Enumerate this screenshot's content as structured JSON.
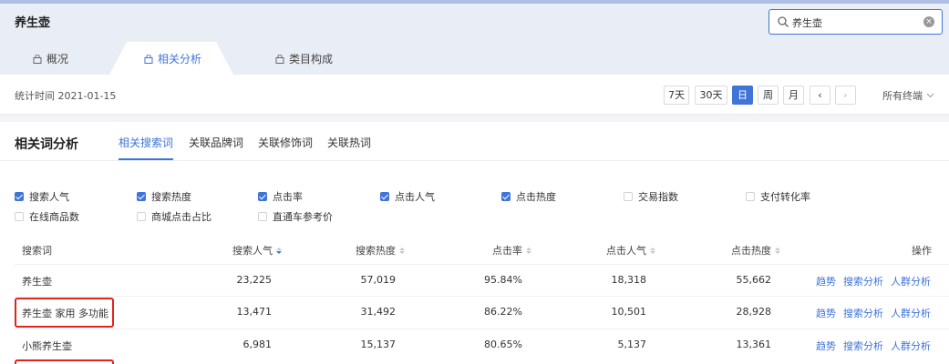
{
  "app": {
    "title": "养生壶"
  },
  "search": {
    "value": "养生壶",
    "placeholder": ""
  },
  "tabs": [
    {
      "label": "概况"
    },
    {
      "label": "相关分析"
    },
    {
      "label": "类目构成"
    }
  ],
  "subbar": {
    "stat_time": "统计时间 2021-01-15",
    "periods": [
      "7天",
      "30天",
      "日",
      "周",
      "月"
    ],
    "prev": "‹",
    "next": "›",
    "channel": "所有终端"
  },
  "card": {
    "title": "相关词分析",
    "tabs": [
      "相关搜索词",
      "关联品牌词",
      "关联修饰词",
      "关联热词"
    ]
  },
  "checkboxes": [
    {
      "label": "搜索人气",
      "checked": true
    },
    {
      "label": "搜索热度",
      "checked": true
    },
    {
      "label": "点击率",
      "checked": true
    },
    {
      "label": "点击人气",
      "checked": true
    },
    {
      "label": "点击热度",
      "checked": true
    },
    {
      "label": "交易指数",
      "checked": false
    },
    {
      "label": "支付转化率",
      "checked": false
    },
    {
      "label": "在线商品数",
      "checked": false
    },
    {
      "label": "商城点击占比",
      "checked": false
    },
    {
      "label": "直通车参考价",
      "checked": false
    }
  ],
  "table": {
    "headers": [
      "搜索词",
      "搜索人气",
      "搜索热度",
      "点击率",
      "点击人气",
      "点击热度",
      "操作"
    ],
    "ops": [
      "趋势",
      "搜索分析",
      "人群分析"
    ],
    "rows": [
      {
        "keyword": "养生壶",
        "c1": "23,225",
        "c2": "57,019",
        "c3": "95.84%",
        "c4": "18,318",
        "c5": "55,662",
        "highlight": false
      },
      {
        "keyword": "养生壶 家用 多功能",
        "c1": "13,471",
        "c2": "31,492",
        "c3": "86.22%",
        "c4": "10,501",
        "c5": "28,928",
        "highlight": true
      },
      {
        "keyword": "小熊养生壶",
        "c1": "6,981",
        "c2": "15,137",
        "c3": "80.65%",
        "c4": "5,137",
        "c5": "13,361",
        "highlight": false
      }
    ]
  },
  "colors": {
    "accent": "#3f74d9",
    "highlight": "#e0251e"
  },
  "icons": {
    "search": "search-icon",
    "tab": "bag-icon",
    "clear": "clear-icon",
    "sort": "sort-icon"
  }
}
